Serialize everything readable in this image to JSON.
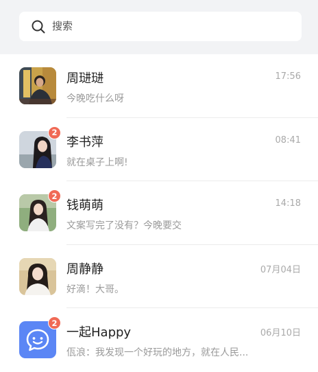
{
  "search": {
    "placeholder": "搜索"
  },
  "chats": [
    {
      "name": "周琎琎",
      "time": "17:56",
      "preview": "今晚吃什么呀",
      "badge": ""
    },
    {
      "name": "李书萍",
      "time": "08:41",
      "preview": "就在桌子上啊!",
      "badge": "2"
    },
    {
      "name": "钱萌萌",
      "time": "14:18",
      "preview": "文案写完了没有？今晚要交",
      "badge": "2"
    },
    {
      "name": "周静静",
      "time": "07月04日",
      "preview": "好滴！大哥。",
      "badge": ""
    },
    {
      "name": "一起Happy",
      "time": "06月10日",
      "preview": "佤浪：我发现一个好玩的地方，就在人民...",
      "badge": "2"
    }
  ],
  "colors": {
    "badge": "#f06a56",
    "group_avatar": "#5b86f5",
    "search_bg": "#f2f3f5"
  }
}
